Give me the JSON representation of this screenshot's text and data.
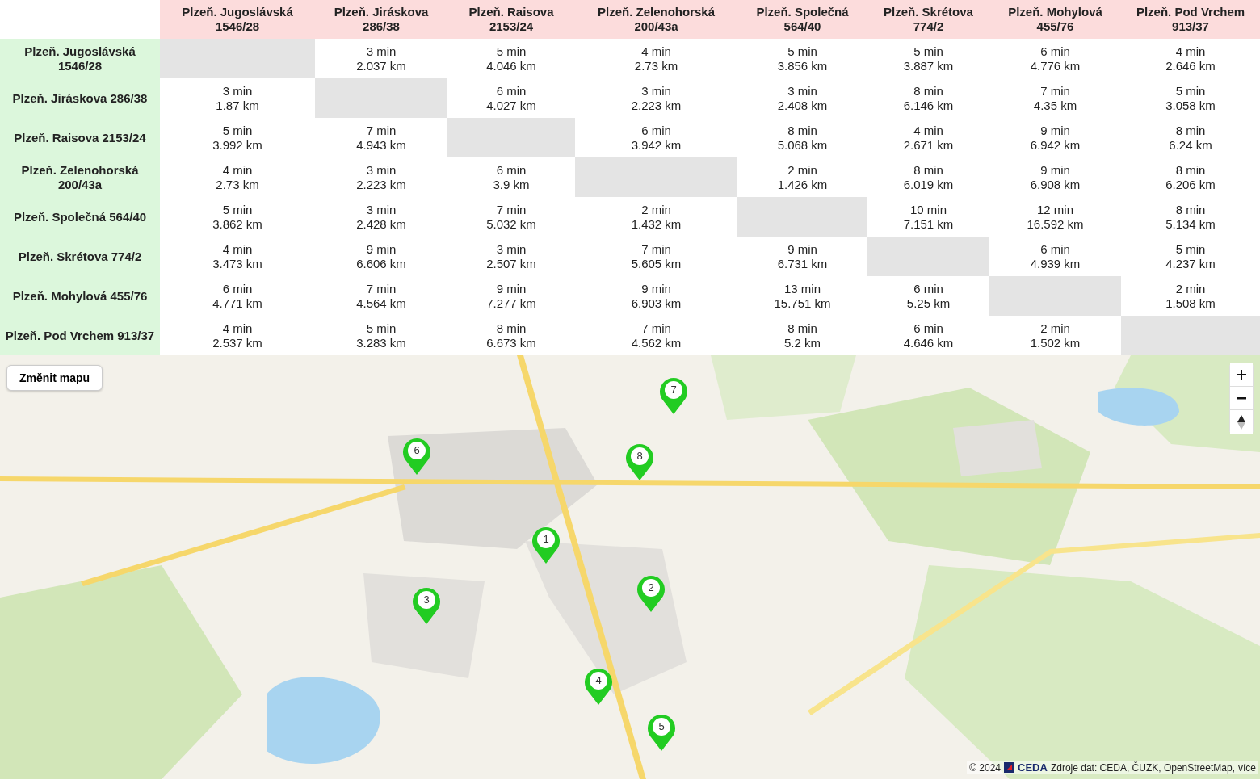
{
  "matrix": {
    "columns": [
      "Plzeň. Jugoslávská 1546/28",
      "Plzeň. Jiráskova 286/38",
      "Plzeň. Raisova 2153/24",
      "Plzeň. Zelenohorská 200/43a",
      "Plzeň. Společná 564/40",
      "Plzeň. Skrétova 774/2",
      "Plzeň. Mohylová 455/76",
      "Plzeň. Pod Vrchem 913/37"
    ],
    "rows": [
      {
        "label": "Plzeň. Jugoslávská 1546/28",
        "cells": [
          {
            "kind": "empty"
          },
          {
            "kind": "route",
            "time": "3 min",
            "distance": "2.037 km"
          },
          {
            "kind": "route",
            "time": "5 min",
            "distance": "4.046 km"
          },
          {
            "kind": "route",
            "time": "4 min",
            "distance": "2.73 km"
          },
          {
            "kind": "route",
            "time": "5 min",
            "distance": "3.856 km"
          },
          {
            "kind": "route",
            "time": "5 min",
            "distance": "3.887 km"
          },
          {
            "kind": "route",
            "time": "6 min",
            "distance": "4.776 km"
          },
          {
            "kind": "route",
            "time": "4 min",
            "distance": "2.646 km"
          }
        ]
      },
      {
        "label": "Plzeň. Jiráskova 286/38",
        "cells": [
          {
            "kind": "route",
            "time": "3 min",
            "distance": "1.87 km"
          },
          {
            "kind": "empty"
          },
          {
            "kind": "route",
            "time": "6 min",
            "distance": "4.027 km"
          },
          {
            "kind": "route",
            "time": "3 min",
            "distance": "2.223 km"
          },
          {
            "kind": "route",
            "time": "3 min",
            "distance": "2.408 km"
          },
          {
            "kind": "route",
            "time": "8 min",
            "distance": "6.146 km"
          },
          {
            "kind": "route",
            "time": "7 min",
            "distance": "4.35 km"
          },
          {
            "kind": "route",
            "time": "5 min",
            "distance": "3.058 km"
          }
        ]
      },
      {
        "label": "Plzeň. Raisova 2153/24",
        "cells": [
          {
            "kind": "route",
            "time": "5 min",
            "distance": "3.992 km"
          },
          {
            "kind": "route",
            "time": "7 min",
            "distance": "4.943 km"
          },
          {
            "kind": "empty"
          },
          {
            "kind": "route",
            "time": "6 min",
            "distance": "3.942 km"
          },
          {
            "kind": "route",
            "time": "8 min",
            "distance": "5.068 km"
          },
          {
            "kind": "route",
            "time": "4 min",
            "distance": "2.671 km"
          },
          {
            "kind": "route",
            "time": "9 min",
            "distance": "6.942 km"
          },
          {
            "kind": "route",
            "time": "8 min",
            "distance": "6.24 km"
          }
        ]
      },
      {
        "label": "Plzeň. Zelenohorská 200/43a",
        "cells": [
          {
            "kind": "route",
            "time": "4 min",
            "distance": "2.73 km"
          },
          {
            "kind": "route",
            "time": "3 min",
            "distance": "2.223 km"
          },
          {
            "kind": "route",
            "time": "6 min",
            "distance": "3.9 km"
          },
          {
            "kind": "empty"
          },
          {
            "kind": "route",
            "time": "2 min",
            "distance": "1.426 km"
          },
          {
            "kind": "route",
            "time": "8 min",
            "distance": "6.019 km"
          },
          {
            "kind": "route",
            "time": "9 min",
            "distance": "6.908 km"
          },
          {
            "kind": "route",
            "time": "8 min",
            "distance": "6.206 km"
          }
        ]
      },
      {
        "label": "Plzeň. Společná 564/40",
        "cells": [
          {
            "kind": "route",
            "time": "5 min",
            "distance": "3.862 km"
          },
          {
            "kind": "route",
            "time": "3 min",
            "distance": "2.428 km"
          },
          {
            "kind": "route",
            "time": "7 min",
            "distance": "5.032 km"
          },
          {
            "kind": "route",
            "time": "2 min",
            "distance": "1.432 km"
          },
          {
            "kind": "empty"
          },
          {
            "kind": "route",
            "time": "10 min",
            "distance": "7.151 km"
          },
          {
            "kind": "route",
            "time": "12 min",
            "distance": "16.592 km"
          },
          {
            "kind": "route",
            "time": "8 min",
            "distance": "5.134 km"
          }
        ]
      },
      {
        "label": "Plzeň. Skrétova 774/2",
        "cells": [
          {
            "kind": "route",
            "time": "4 min",
            "distance": "3.473 km"
          },
          {
            "kind": "route",
            "time": "9 min",
            "distance": "6.606 km"
          },
          {
            "kind": "route",
            "time": "3 min",
            "distance": "2.507 km"
          },
          {
            "kind": "route",
            "time": "7 min",
            "distance": "5.605 km"
          },
          {
            "kind": "route",
            "time": "9 min",
            "distance": "6.731 km"
          },
          {
            "kind": "empty"
          },
          {
            "kind": "route",
            "time": "6 min",
            "distance": "4.939 km"
          },
          {
            "kind": "route",
            "time": "5 min",
            "distance": "4.237 km"
          }
        ]
      },
      {
        "label": "Plzeň. Mohylová 455/76",
        "cells": [
          {
            "kind": "route",
            "time": "6 min",
            "distance": "4.771 km"
          },
          {
            "kind": "route",
            "time": "7 min",
            "distance": "4.564 km"
          },
          {
            "kind": "route",
            "time": "9 min",
            "distance": "7.277 km"
          },
          {
            "kind": "route",
            "time": "9 min",
            "distance": "6.903 km"
          },
          {
            "kind": "route",
            "time": "13 min",
            "distance": "15.751 km"
          },
          {
            "kind": "route",
            "time": "6 min",
            "distance": "5.25 km"
          },
          {
            "kind": "empty"
          },
          {
            "kind": "route",
            "time": "2 min",
            "distance": "1.508 km"
          }
        ]
      },
      {
        "label": "Plzeň. Pod Vrchem 913/37",
        "cells": [
          {
            "kind": "route",
            "time": "4 min",
            "distance": "2.537 km"
          },
          {
            "kind": "route",
            "time": "5 min",
            "distance": "3.283 km"
          },
          {
            "kind": "route",
            "time": "8 min",
            "distance": "6.673 km"
          },
          {
            "kind": "route",
            "time": "7 min",
            "distance": "4.562 km"
          },
          {
            "kind": "route",
            "time": "8 min",
            "distance": "5.2 km"
          },
          {
            "kind": "route",
            "time": "6 min",
            "distance": "4.646 km"
          },
          {
            "kind": "route",
            "time": "2 min",
            "distance": "1.502 km"
          },
          {
            "kind": "empty"
          }
        ]
      }
    ]
  },
  "map": {
    "kind": "picture",
    "switch_button": "Změnit mapu",
    "markers": [
      "1",
      "2",
      "3",
      "4",
      "5",
      "6",
      "7",
      "8"
    ],
    "attribution": {
      "year": "© 2024",
      "brand": "CEDA",
      "sources": "Zdroje dat: CEDA, ČUZK, OpenStreetMap,",
      "link": "více"
    }
  }
}
